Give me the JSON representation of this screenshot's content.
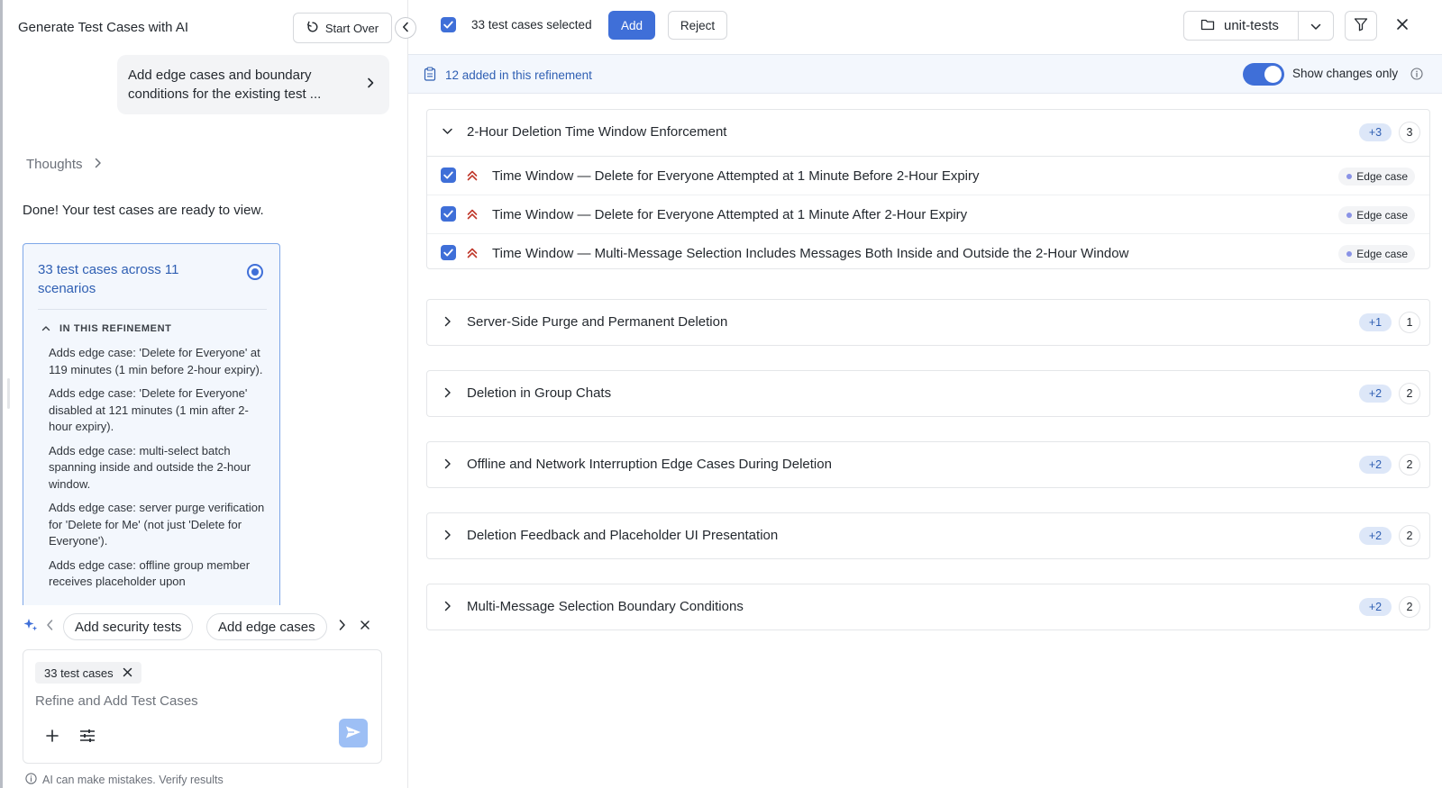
{
  "left": {
    "title": "Generate Test Cases with AI",
    "start_over_label": "Start Over",
    "prompt": "Add edge cases and boundary conditions for the existing test ...",
    "thoughts_label": "Thoughts",
    "done_message": "Done! Your test cases are ready to view.",
    "summary": {
      "title": "33 test cases across 11 scenarios",
      "refinement_header": "IN THIS REFINEMENT",
      "items": [
        "Adds edge case: 'Delete for Everyone' at 119 minutes (1 min before 2-hour expiry).",
        "Adds edge case: 'Delete for Everyone' disabled at 121 minutes (1 min after 2-hour expiry).",
        "Adds edge case: multi-select batch spanning inside and outside the 2-hour window.",
        "Adds edge case: server purge verification for 'Delete for Me' (not just 'Delete for Everyone').",
        "Adds edge case: offline group member receives placeholder upon"
      ]
    },
    "suggestions": [
      "Add security tests",
      "Add edge cases"
    ],
    "composer": {
      "tag": "33 test cases",
      "placeholder": "Refine and Add Test Cases"
    },
    "disclaimer": "AI can make mistakes. Verify results"
  },
  "toolbar": {
    "selected_label": "33 test cases selected",
    "add_label": "Add",
    "reject_label": "Reject",
    "folder": "unit-tests"
  },
  "info_bar": {
    "added_text": "12 added in this refinement",
    "toggle_label": "Show changes only"
  },
  "groups": [
    {
      "title": "2-Hour Deletion Time Window Enforcement",
      "added": "+3",
      "count": "3",
      "expanded": true,
      "cases": [
        {
          "title": "Time Window — Delete for Everyone Attempted at 1 Minute Before 2-Hour Expiry",
          "tag": "Edge case"
        },
        {
          "title": "Time Window — Delete for Everyone Attempted at 1 Minute After 2-Hour Expiry",
          "tag": "Edge case"
        },
        {
          "title": "Time Window — Multi-Message Selection Includes Messages Both Inside and Outside the 2-Hour Window",
          "tag": "Edge case"
        }
      ]
    },
    {
      "title": "Server-Side Purge and Permanent Deletion",
      "added": "+1",
      "count": "1",
      "expanded": false
    },
    {
      "title": "Deletion in Group Chats",
      "added": "+2",
      "count": "2",
      "expanded": false
    },
    {
      "title": "Offline and Network Interruption Edge Cases During Deletion",
      "added": "+2",
      "count": "2",
      "expanded": false
    },
    {
      "title": "Deletion Feedback and Placeholder UI Presentation",
      "added": "+2",
      "count": "2",
      "expanded": false
    },
    {
      "title": "Multi-Message Selection Boundary Conditions",
      "added": "+2",
      "count": "2",
      "expanded": false
    }
  ],
  "colors": {
    "accent": "#3f6fd8",
    "priority_high": "#c0392b",
    "info_bg": "#f3f7fd"
  }
}
